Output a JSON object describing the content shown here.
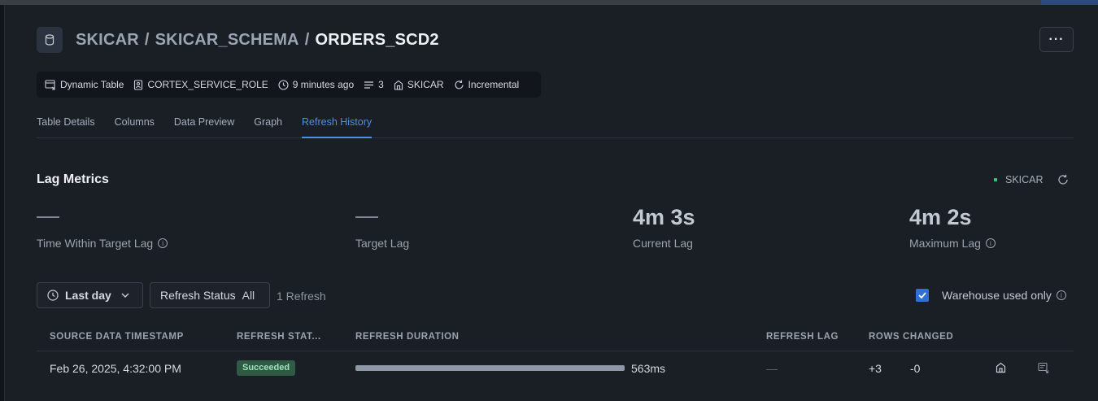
{
  "header": {
    "breadcrumb": [
      "SKICAR",
      "SKICAR_SCHEMA"
    ],
    "separator": "/",
    "current": "ORDERS_SCD2",
    "more_label": "···"
  },
  "meta": {
    "type": "Dynamic Table",
    "role": "CORTEX_SERVICE_ROLE",
    "updated": "9 minutes ago",
    "count": "3",
    "warehouse": "SKICAR",
    "refresh_mode": "Incremental"
  },
  "tabs": [
    {
      "label": "Table Details",
      "active": false
    },
    {
      "label": "Columns",
      "active": false
    },
    {
      "label": "Data Preview",
      "active": false
    },
    {
      "label": "Graph",
      "active": false
    },
    {
      "label": "Refresh History",
      "active": true
    }
  ],
  "lag": {
    "title": "Lag Metrics",
    "warehouse": "SKICAR",
    "metrics": [
      {
        "value": "",
        "label": "Time Within Target Lag",
        "info": true
      },
      {
        "value": "",
        "label": "Target Lag",
        "info": false
      },
      {
        "value": "4m 3s",
        "label": "Current Lag",
        "info": false
      },
      {
        "value": "4m 2s",
        "label": "Maximum Lag",
        "info": true
      }
    ]
  },
  "filters": {
    "range": "Last day",
    "status_label": "Refresh Status",
    "status_value": "All",
    "count": "1 Refresh",
    "warehouse_only": "Warehouse used only",
    "warehouse_only_checked": true
  },
  "table": {
    "columns": [
      "SOURCE DATA TIMESTAMP",
      "REFRESH STAT...",
      "REFRESH DURATION",
      "REFRESH LAG",
      "ROWS CHANGED"
    ],
    "rows": [
      {
        "timestamp": "Feb 26, 2025, 4:32:00 PM",
        "status": "Succeeded",
        "duration": "563ms",
        "duration_fraction": 1.0,
        "lag": "—",
        "added": "+3",
        "removed": "-0"
      }
    ]
  },
  "colors": {
    "accent": "#4d8fe8",
    "success_bg": "#2f5a44",
    "success_fg": "#9fe0bd",
    "warehouse_dot": "#35c07a"
  }
}
